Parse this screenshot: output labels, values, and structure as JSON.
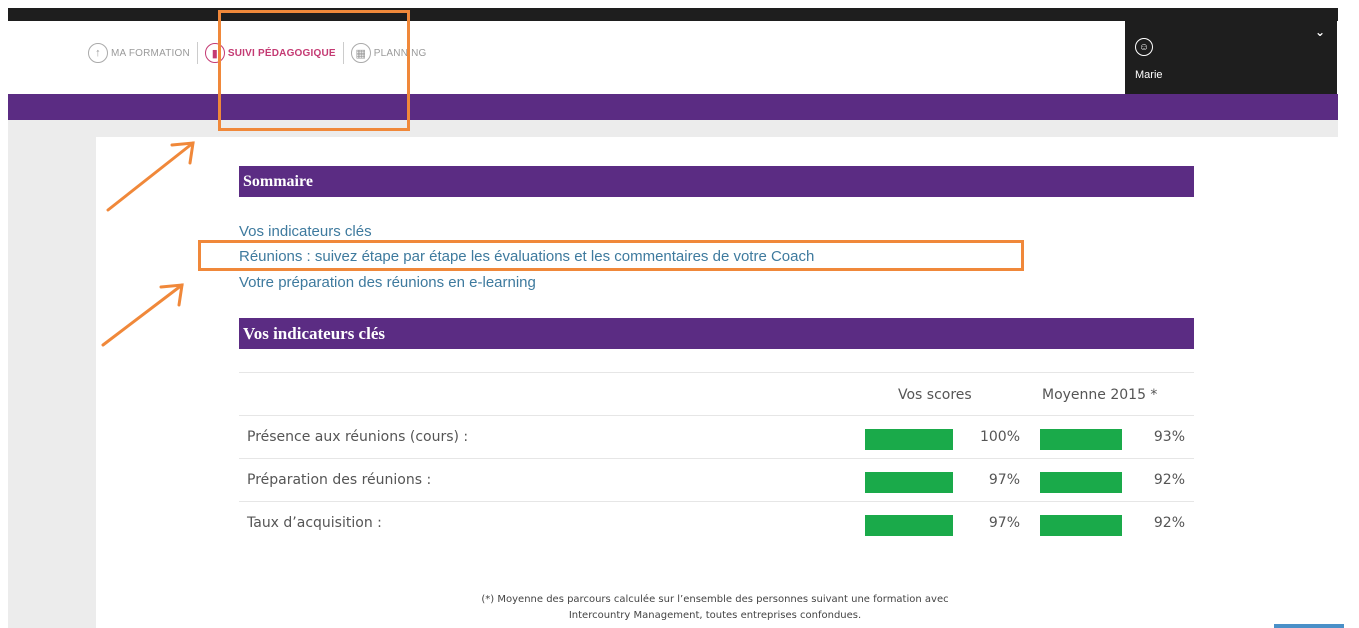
{
  "nav": {
    "items": [
      {
        "label": "MA FORMATION",
        "icon": "arrow-up-icon"
      },
      {
        "label": "SUIVI PÉDAGOGIQUE",
        "icon": "chart-icon"
      },
      {
        "label": "PLANNING",
        "icon": "calendar-icon"
      }
    ],
    "active_color": "#c43a73"
  },
  "user": {
    "name": "Marie",
    "icon": "user-icon"
  },
  "colors": {
    "brand": "#5b2c83",
    "bar": "#1aaa4a",
    "link": "#3e7a9e",
    "annotation": "#f0883a"
  },
  "summary": {
    "title": "Sommaire",
    "links": [
      "Vos indicateurs clés",
      "Réunions : suivez étape par étape les évaluations et les commentaires de votre Coach",
      "Votre préparation des réunions en e-learning"
    ]
  },
  "indicators": {
    "title": "Vos indicateurs clés",
    "col_scores": "Vos scores",
    "col_avg": "Moyenne 2015 *",
    "rows": [
      {
        "label": "Présence aux réunions (cours) :",
        "score": "100%",
        "avg": "93%",
        "score_value": 100,
        "avg_value": 93
      },
      {
        "label": "Préparation des réunions :",
        "score": "97%",
        "avg": "92%",
        "score_value": 97,
        "avg_value": 92
      },
      {
        "label": "Taux d’acquisition :",
        "score": "97%",
        "avg": "92%",
        "score_value": 97,
        "avg_value": 92
      }
    ]
  },
  "footnote": {
    "line1": "(*) Moyenne des parcours calculée sur l’ensemble des personnes suivant une formation avec",
    "line2": "Intercountry Management, toutes entreprises confondues."
  }
}
